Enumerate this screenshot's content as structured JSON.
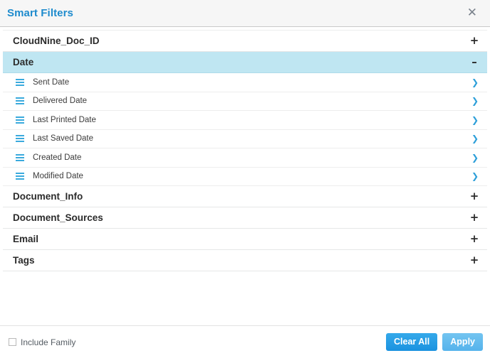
{
  "titlebar": {
    "title": "Smart Filters",
    "close_icon": "close-icon",
    "close_glyph": "✕"
  },
  "icons": {
    "expand": "+",
    "collapse": "–",
    "chevron_right": "❯",
    "grip": "grip-icon"
  },
  "colors": {
    "title_blue": "#1e8bcd",
    "expanded_row_bg": "#bfe6f2",
    "icon_blue": "#2d9fd9",
    "clear_button": "#1a92e0",
    "apply_button": "#55b3ec"
  },
  "filters": [
    {
      "label": "CloudNine_Doc_ID",
      "expanded": false,
      "toggle": "+",
      "items": []
    },
    {
      "label": "Date",
      "expanded": true,
      "toggle": "–",
      "items": [
        {
          "label": "Sent Date"
        },
        {
          "label": "Delivered Date"
        },
        {
          "label": "Last Printed Date"
        },
        {
          "label": "Last Saved Date"
        },
        {
          "label": "Created Date"
        },
        {
          "label": "Modified Date"
        }
      ]
    },
    {
      "label": "Document_Info",
      "expanded": false,
      "toggle": "+",
      "items": []
    },
    {
      "label": "Document_Sources",
      "expanded": false,
      "toggle": "+",
      "items": []
    },
    {
      "label": "Email",
      "expanded": false,
      "toggle": "+",
      "items": []
    },
    {
      "label": "Tags",
      "expanded": false,
      "toggle": "+",
      "items": []
    }
  ],
  "footer": {
    "include_family_label": "Include Family",
    "include_family_checked": false,
    "clear_all_label": "Clear All",
    "apply_label": "Apply"
  }
}
